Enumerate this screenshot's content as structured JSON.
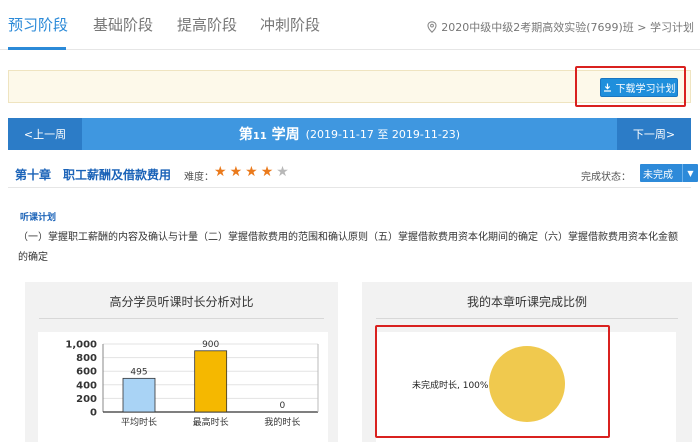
{
  "tabs": [
    {
      "label": "预习阶段",
      "active": true
    },
    {
      "label": "基础阶段",
      "active": false
    },
    {
      "label": "提高阶段",
      "active": false
    },
    {
      "label": "冲刺阶段",
      "active": false
    }
  ],
  "breadcrumb": "2020中级中级2考期高效实验(7699)班 > 学习计划",
  "download": {
    "label": "下载学习计划",
    "icon": "download-icon"
  },
  "week": {
    "prev": "<上一周",
    "next": "下一周>",
    "prefix": "第",
    "number": "11",
    "suffix": " 学周",
    "dates": "(2019-11-17 至 2019-11-23)"
  },
  "chapter": {
    "title": "第十章　职工薪酬及借款费用",
    "difficulty_label": "难度：",
    "difficulty": 4,
    "difficulty_max": 5,
    "status_label": "完成状态：",
    "status_value": "未完成"
  },
  "plan": {
    "label": "听课计划",
    "text": "（一）掌握职工薪酬的内容及确认与计量（二）掌握借款费用的范围和确认原则（五）掌握借款费用资本化期间的确定（六）掌握借款费用资本化金额的确定"
  },
  "colors": {
    "accent": "#2b8ad8",
    "bar_avg": "#a9d3f5",
    "bar_max": "#f5b800",
    "pie": "#f0c94e",
    "highlight": "#d9211f"
  },
  "chart_data": [
    {
      "type": "bar",
      "title": "高分学员听课时长分析对比",
      "categories": [
        "平均时长",
        "最高时长",
        "我的时长"
      ],
      "values": [
        495,
        900,
        0
      ],
      "ylim": [
        0,
        1000
      ],
      "yticks": [
        "0",
        "200",
        "400",
        "600",
        "800",
        "1,000"
      ],
      "grid": true
    },
    {
      "type": "pie",
      "title": "我的本章听课完成比例",
      "slices": [
        {
          "label": "未完成时长, 100%",
          "value": 100
        }
      ]
    }
  ]
}
